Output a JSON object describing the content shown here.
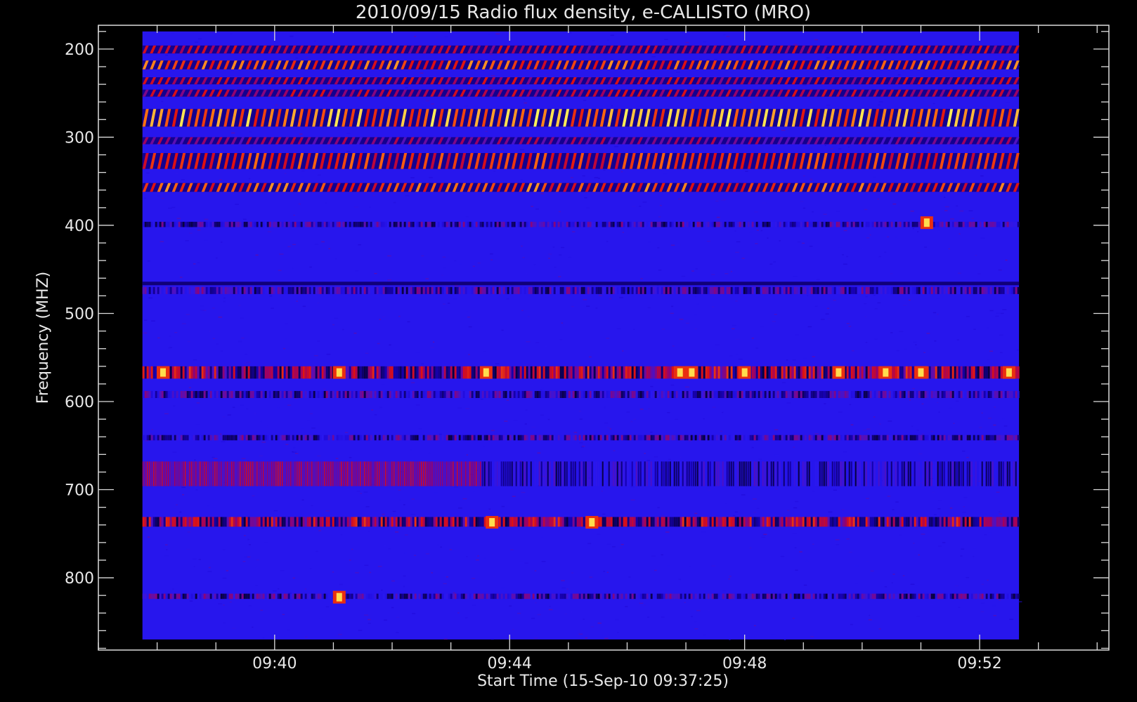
{
  "chart_data": {
    "type": "heatmap",
    "title": "2010/09/15  Radio flux density, e-CALLISTO (MRO)",
    "xlabel": "Start Time (15-Sep-10 09:37:25)",
    "ylabel": "Frequency (MHZ)",
    "x_tick_labels": [
      "09:40",
      "09:44",
      "09:48",
      "09:52"
    ],
    "x_tick_minutes": [
      40,
      44,
      48,
      52
    ],
    "y_ticks": [
      200,
      300,
      400,
      500,
      600,
      700,
      800
    ],
    "x_range_minutes": [
      37.0,
      54.2
    ],
    "y_range_mhz": [
      173,
      882
    ],
    "data_time_range_minutes": [
      37.75,
      52.67
    ],
    "data_freq_range_mhz": [
      180,
      870
    ],
    "colormap": [
      "#000000",
      "#1a00c8",
      "#2818f0",
      "#a00060",
      "#e01010",
      "#ff7010",
      "#ffff60"
    ],
    "background_level": 0.32,
    "features": [
      {
        "label": "periodic interference band",
        "freq_range": [
          196,
          205
        ],
        "intensity": 0.6,
        "pattern": "periodic-diagonal"
      },
      {
        "label": "periodic interference band",
        "freq_range": [
          213,
          223
        ],
        "intensity": 0.8,
        "pattern": "periodic-diagonal"
      },
      {
        "label": "periodic interference band",
        "freq_range": [
          232,
          240
        ],
        "intensity": 0.6,
        "pattern": "periodic-diagonal"
      },
      {
        "label": "periodic interference band",
        "freq_range": [
          246,
          254
        ],
        "intensity": 0.6,
        "pattern": "periodic-diagonal"
      },
      {
        "label": "periodic interference band",
        "freq_range": [
          268,
          288
        ],
        "intensity": 0.9,
        "pattern": "periodic-diagonal"
      },
      {
        "label": "periodic interference band",
        "freq_range": [
          300,
          308
        ],
        "intensity": 0.5,
        "pattern": "periodic-diagonal"
      },
      {
        "label": "periodic interference band",
        "freq_range": [
          318,
          336
        ],
        "intensity": 0.75,
        "pattern": "periodic-diagonal"
      },
      {
        "label": "periodic interference band",
        "freq_range": [
          352,
          362
        ],
        "intensity": 0.8,
        "pattern": "periodic-diagonal"
      },
      {
        "label": "weak band",
        "freq_range": [
          396,
          402
        ],
        "intensity": 0.45,
        "pattern": "speckle"
      },
      {
        "label": "dark band",
        "freq_range": [
          464,
          468
        ],
        "intensity": 0.1,
        "pattern": "dark-line"
      },
      {
        "label": "weak band",
        "freq_range": [
          470,
          478
        ],
        "intensity": 0.45,
        "pattern": "speckle"
      },
      {
        "label": "bursty band",
        "freq_range": [
          560,
          574
        ],
        "intensity": 0.7,
        "pattern": "bursts"
      },
      {
        "label": "weak band",
        "freq_range": [
          588,
          596
        ],
        "intensity": 0.45,
        "pattern": "speckle"
      },
      {
        "label": "weak band",
        "freq_range": [
          638,
          644
        ],
        "intensity": 0.45,
        "pattern": "speckle"
      },
      {
        "label": "striped band",
        "freq_range": [
          668,
          696
        ],
        "intensity": 0.5,
        "pattern": "vertical-stripes"
      },
      {
        "label": "strong band",
        "freq_range": [
          731,
          742
        ],
        "intensity": 0.7,
        "pattern": "speckle"
      },
      {
        "label": "weak band",
        "freq_range": [
          818,
          824
        ],
        "intensity": 0.45,
        "pattern": "speckle"
      }
    ],
    "hotspots": [
      {
        "t": 38.1,
        "f": 567
      },
      {
        "t": 41.1,
        "f": 567
      },
      {
        "t": 43.6,
        "f": 567
      },
      {
        "t": 46.9,
        "f": 567
      },
      {
        "t": 47.1,
        "f": 567
      },
      {
        "t": 48.0,
        "f": 567
      },
      {
        "t": 49.6,
        "f": 567
      },
      {
        "t": 50.4,
        "f": 567
      },
      {
        "t": 51.0,
        "f": 567
      },
      {
        "t": 52.5,
        "f": 567
      },
      {
        "t": 43.7,
        "f": 737
      },
      {
        "t": 45.4,
        "f": 737
      },
      {
        "t": 51.1,
        "f": 397
      },
      {
        "t": 41.1,
        "f": 822
      }
    ],
    "grid": false,
    "legend": "none"
  }
}
